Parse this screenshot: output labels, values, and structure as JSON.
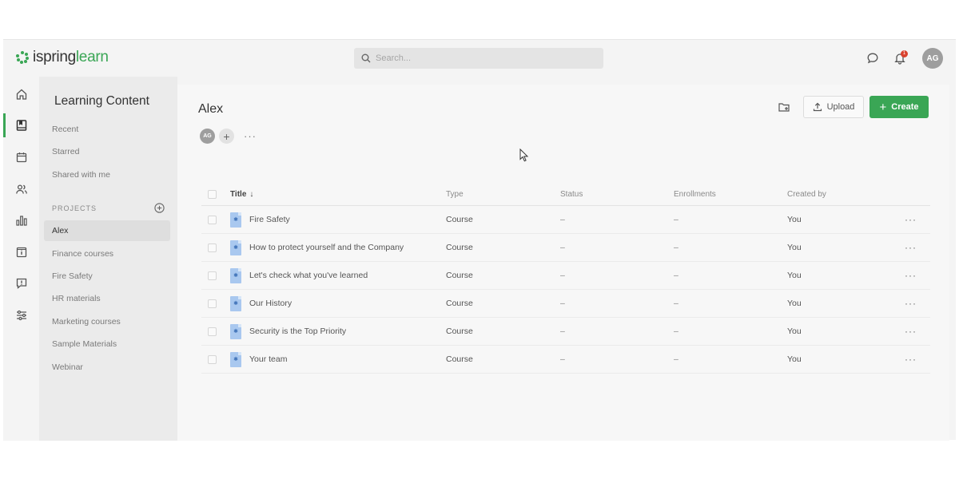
{
  "brand": {
    "name_part1": "ispring",
    "name_part2": "learn"
  },
  "search": {
    "placeholder": "Search..."
  },
  "header": {
    "notification_count": "1",
    "user_initials": "AG"
  },
  "rail": {
    "items": [
      {
        "icon": "home-icon"
      },
      {
        "icon": "content-icon",
        "active": true
      },
      {
        "icon": "calendar-icon"
      },
      {
        "icon": "users-icon"
      },
      {
        "icon": "reports-icon"
      },
      {
        "icon": "info-icon"
      },
      {
        "icon": "feedback-icon"
      },
      {
        "icon": "settings-icon"
      }
    ]
  },
  "sidebar": {
    "title": "Learning Content",
    "links": [
      "Recent",
      "Starred",
      "Shared with me"
    ],
    "projects_label": "PROJECTS",
    "projects": [
      "Alex",
      "Finance courses",
      "Fire Safety",
      "HR materials",
      "Marketing courses",
      "Sample Materials",
      "Webinar"
    ],
    "active_project": "Alex"
  },
  "main": {
    "title": "Alex",
    "member_initials": "AG",
    "add_member": "+",
    "more": "···",
    "upload_label": "Upload",
    "create_label": "Create",
    "create_plus": "+"
  },
  "table": {
    "columns": [
      "Title",
      "Type",
      "Status",
      "Enrollments",
      "Created by"
    ],
    "sort_indicator": "↓",
    "rows": [
      {
        "title": "Fire Safety",
        "type": "Course",
        "status": "–",
        "enrollments": "–",
        "created_by": "You"
      },
      {
        "title": "How to protect yourself and the Company",
        "type": "Course",
        "status": "–",
        "enrollments": "–",
        "created_by": "You"
      },
      {
        "title": "Let's check what you've learned",
        "type": "Course",
        "status": "–",
        "enrollments": "–",
        "created_by": "You"
      },
      {
        "title": "Our History",
        "type": "Course",
        "status": "–",
        "enrollments": "–",
        "created_by": "You"
      },
      {
        "title": "Security is the Top Priority",
        "type": "Course",
        "status": "–",
        "enrollments": "–",
        "created_by": "You"
      },
      {
        "title": "Your team",
        "type": "Course",
        "status": "–",
        "enrollments": "–",
        "created_by": "You"
      }
    ],
    "row_more": "···"
  },
  "colors": {
    "accent": "#3aa655",
    "badge": "#d9432f",
    "file_icon": "#a9c8ef"
  }
}
